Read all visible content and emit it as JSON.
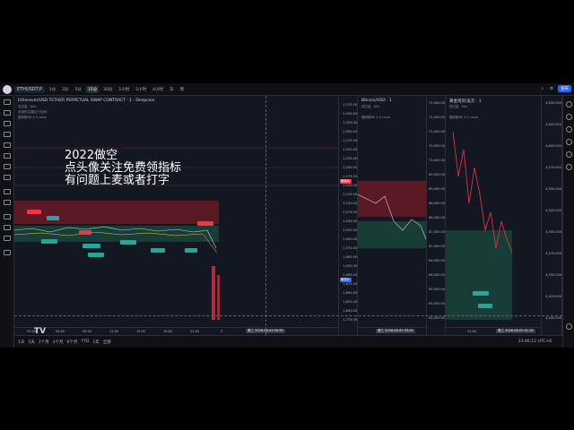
{
  "toolbar": {
    "symbol": "ETHUSDT.P",
    "intervals": [
      "1分",
      "3分",
      "5分",
      "15分",
      "30分",
      "1小时",
      "2小时",
      "4小时",
      "天",
      "周"
    ],
    "publish_label": "发布"
  },
  "panes": [
    {
      "title": "Ethereum/USD TETHER PERPETUAL SWAP CONTRACT · 1 · Deepcoin",
      "volume_label": "成交量 · tlds",
      "indicator_1": "多组别主要压力位BK",
      "indicator_2": "猎网股BK 4.5 close",
      "price_labels": [
        "2,375.00",
        "2,350.00",
        "2,325.00",
        "2,300.00",
        "2,275.00",
        "2,250.00",
        "2,225.00",
        "2,200.00",
        "2,175.00",
        "2,150.00",
        "2,125.00",
        "2,100.00",
        "2,075.00",
        "2,050.00",
        "2,025.00",
        "2,000.00",
        "1,975.00",
        "1,950.00",
        "1,925.00",
        "1,900.00",
        "1,875.00",
        "1,850.00",
        "1,825.00",
        "1,800.00",
        "1,775.00"
      ],
      "tags": [
        {
          "text": "最高价",
          "color": "#f23645"
        },
        {
          "text": "最低价",
          "color": "#2962ff"
        }
      ],
      "time_labels": [
        "03:00",
        "06:00",
        "09:00",
        "12:00",
        "15:00",
        "18:00",
        "21:00",
        "3"
      ],
      "date_tag": "周三 2026-06-03 04:59"
    },
    {
      "title": "Bitcoin/USD · 1",
      "volume_label": "成交量 · tlds",
      "indicator": "猎网股BK 4.5 close",
      "price_labels": [
        "72,000.00",
        "71,500.00",
        "71,000.00",
        "70,500.00",
        "70,000.00",
        "69,500.00",
        "69,000.00",
        "68,500.00",
        "68,000.00",
        "67,500.00",
        "67,000.00",
        "66,500.00",
        "66,000.00",
        "65,500.00",
        "65,000.00",
        "64,500.00"
      ],
      "date_tag": "周三 2026-06-03 03:04"
    },
    {
      "title": "黄金现货/美元 · 1",
      "volume_label": "成交量 · tlds",
      "indicator": "猎网股BK 4.5 close",
      "price_labels": [
        "4,650.000",
        "4,625.000",
        "4,600.000",
        "4,575.000",
        "4,550.000",
        "4,525.000",
        "4,500.000",
        "4,475.000",
        "4,450.000",
        "4,425.000",
        "4,400.000"
      ],
      "time_labels": [
        "22:00"
      ],
      "date_tag": "周三 2026-06-03 01:18"
    }
  ],
  "overlay_lines": [
    "2022做空",
    "点头像关注免费领指标",
    "有问题上麦或者打字"
  ],
  "bottombar": {
    "ranges": [
      "1天",
      "5天",
      "1个月",
      "3个月",
      "6个月",
      "YTD",
      "1年",
      "全部"
    ],
    "clock": "23:46:12 UTC+8"
  },
  "colors": {
    "bg": "#131722",
    "up": "#26a69a",
    "down": "#f23645",
    "accent": "#2962ff"
  }
}
